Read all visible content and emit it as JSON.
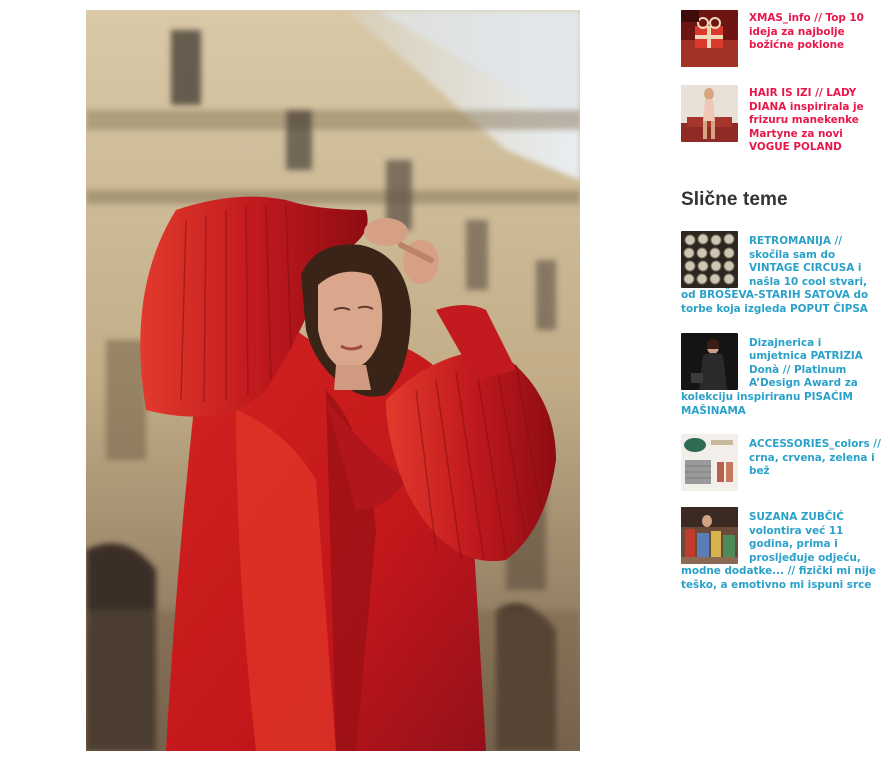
{
  "hero": {
    "alt": "Model in red pleated-sleeve coat in a gallery",
    "palette": {
      "coat": "#c81a1e",
      "coat_dark": "#8e0c12",
      "skin": "#d9a48a",
      "hair": "#3a2418"
    }
  },
  "recent_posts": [
    {
      "title": "XMAS_info // Top 10 ideja za najbolje božićne poklone",
      "thumb_icon": "gift-photo",
      "color": "#e8174b"
    },
    {
      "title": "HAIR IS IZI // LADY DIANA inspirirala je frizuru manekenke Martyne za novi VOGUE POLAND",
      "thumb_icon": "model-photo",
      "color": "#e8174b"
    }
  ],
  "related": {
    "heading": "Slične teme",
    "items": [
      {
        "title": "RETROMANIJA // skočila sam do VINTAGE CIRCUSA i našla 10 cool stvari, od BROŠEVA-STARIH SATOVA do torbe koja izgleda POPUT ČIPSA",
        "thumb_icon": "watches-photo"
      },
      {
        "title": "Dizajnerica i umjetnica PATRIZIA Donà // Platinum A’Design Award za kolekciju inspiriranu PISAĆIM MAŠINAMA",
        "thumb_icon": "designer-photo"
      },
      {
        "title": "ACCESSORIES_colors // crna, crvena, zelena i bež",
        "thumb_icon": "accessories-photo"
      },
      {
        "title": "SUZANA ZUBČIĆ volontira već 11 godina, prima i prosljeđuje odjeću, modne dodatke... // fizički mi nije teško, a emotivno mi ispuni srce",
        "thumb_icon": "volunteer-photo"
      }
    ],
    "link_color": "#2aa1c9"
  }
}
